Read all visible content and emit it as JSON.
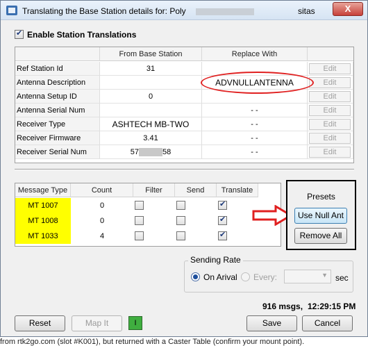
{
  "window": {
    "title_visible": "Translating the Base Station details for: Poly",
    "title_suffix_visible": "sitas",
    "close_glyph": "X",
    "accent_color": "#3a6fb0"
  },
  "enable": {
    "label": "Enable Station Translations",
    "checked": true
  },
  "translation_table": {
    "columns": [
      "",
      "From Base Station",
      "Replace With",
      ""
    ],
    "edit_label": "Edit",
    "rows": [
      {
        "name": "Ref Station Id",
        "from": "31",
        "replace": ""
      },
      {
        "name": "Antenna Description",
        "from": "",
        "replace": "ADVNULLANTENNA"
      },
      {
        "name": "Antenna Setup ID",
        "from": "0",
        "replace": ""
      },
      {
        "name": "Antenna Serial Num",
        "from": "",
        "replace": "- -"
      },
      {
        "name": "Receiver Type",
        "from": "ASHTECH MB-TWO",
        "replace": "- -"
      },
      {
        "name": "Receiver Firmware",
        "from": "3.41",
        "replace": "- -"
      },
      {
        "name": "Receiver Serial Num",
        "from_prefix": "57",
        "from_suffix": "58",
        "replace": "- -"
      }
    ],
    "highlight_color": "#e02020"
  },
  "message_table": {
    "columns": [
      "Message Type",
      "Count",
      "Filter",
      "Send",
      "Translate"
    ],
    "rows": [
      {
        "type": "MT 1007",
        "count": "0",
        "filter": false,
        "send": false,
        "translate": true
      },
      {
        "type": "MT 1008",
        "count": "0",
        "filter": false,
        "send": false,
        "translate": true
      },
      {
        "type": "MT 1033",
        "count": "4",
        "filter": false,
        "send": false,
        "translate": true
      }
    ],
    "type_highlight": "#ffff00"
  },
  "presets": {
    "title": "Presets",
    "use_null_ant": "Use Null Ant",
    "remove_all": "Remove All"
  },
  "sending_rate": {
    "title": "Sending Rate",
    "on_arrival": "On Arival",
    "every": "Every:",
    "unit": "sec",
    "selected": "on_arrival"
  },
  "status": {
    "messages": "916 msgs,",
    "time": "12:29:15 PM"
  },
  "footer": {
    "reset": "Reset",
    "map_it": "Map It",
    "indicator": "I",
    "save": "Save",
    "cancel": "Cancel"
  },
  "background_caption": "from rtk2go.com (slot #K001), but returned with a Caster Table (confirm your mount point)."
}
